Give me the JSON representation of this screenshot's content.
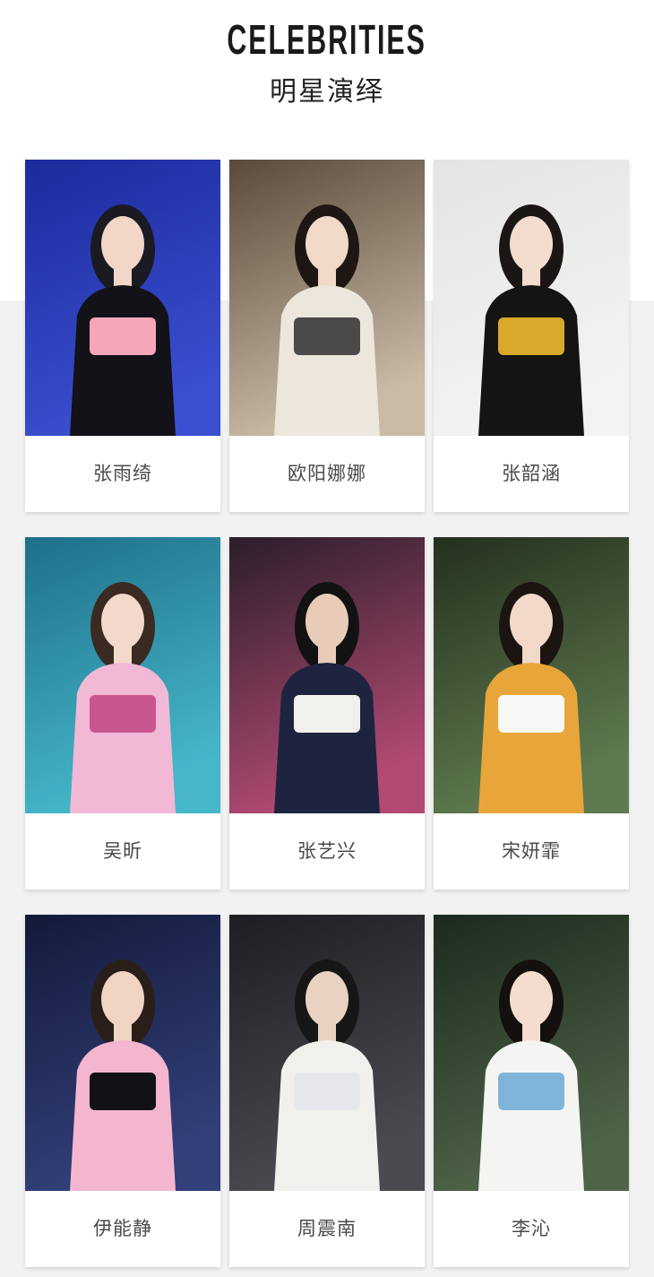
{
  "header": {
    "title": "CELEBRITIES",
    "subtitle": "明星演绎"
  },
  "celebrities": [
    {
      "name": "张雨绮",
      "photo": {
        "bg_top": "#1c2a9c",
        "bg_bottom": "#3a4fd0",
        "hair": "#1a1a22",
        "skin": "#f2d6c8",
        "outfit": "#121218",
        "accent": "#f3a7b8"
      }
    },
    {
      "name": "欧阳娜娜",
      "photo": {
        "bg_top": "#5a4a3a",
        "bg_bottom": "#c9bba6",
        "hair": "#1e1612",
        "skin": "#f1d9c9",
        "outfit": "#ece6dc",
        "accent": "#4a4a48"
      }
    },
    {
      "name": "张韶涵",
      "photo": {
        "bg_top": "#e4e4e2",
        "bg_bottom": "#f3f3f1",
        "hair": "#1a1614",
        "skin": "#f2dccd",
        "outfit": "#161412",
        "accent": "#d8a82a"
      }
    },
    {
      "name": "吴昕",
      "photo": {
        "bg_top": "#1f6f8a",
        "bg_bottom": "#45b7c9",
        "hair": "#3a2a22",
        "skin": "#f3d8cc",
        "outfit": "#f1b9d6",
        "accent": "#c9578f"
      }
    },
    {
      "name": "张艺兴",
      "photo": {
        "bg_top": "#2a1e2a",
        "bg_bottom": "#b24a72",
        "hair": "#121212",
        "skin": "#e9ccb8",
        "outfit": "#1e2440",
        "accent": "#f2f0ec"
      }
    },
    {
      "name": "宋妍霏",
      "photo": {
        "bg_top": "#24301e",
        "bg_bottom": "#5e7a4e",
        "hair": "#1c1410",
        "skin": "#f1d8c9",
        "outfit": "#e8a63a",
        "accent": "#f7f7f5"
      }
    },
    {
      "name": "伊能静",
      "photo": {
        "bg_top": "#121a3a",
        "bg_bottom": "#33407a",
        "hair": "#2a1e18",
        "skin": "#f0d4c4",
        "outfit": "#f4b6cf",
        "accent": "#111116"
      }
    },
    {
      "name": "周震南",
      "photo": {
        "bg_top": "#1e1e22",
        "bg_bottom": "#4a4a50",
        "hair": "#161616",
        "skin": "#ead2c2",
        "outfit": "#f2f0ec",
        "accent": "#e6e8ec"
      }
    },
    {
      "name": "李沁",
      "photo": {
        "bg_top": "#1c2a1e",
        "bg_bottom": "#4e6448",
        "hair": "#14100e",
        "skin": "#f4dccf",
        "outfit": "#f4f4f2",
        "accent": "#7fb4d8"
      }
    }
  ]
}
